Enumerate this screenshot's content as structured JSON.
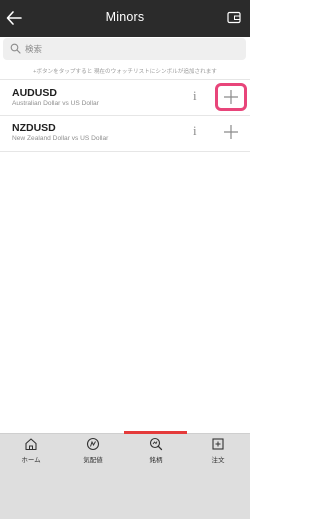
{
  "header": {
    "title": "Minors",
    "back_icon": "arrow-left-icon",
    "right_icon": "wallet-icon"
  },
  "search": {
    "placeholder": "検索",
    "icon": "search-icon"
  },
  "hint_text": "+ボタンをタップすると 現在のウォッチリストにシンボルが追加されます",
  "instruments": [
    {
      "symbol": "AUDUSD",
      "description": "Australian Dollar vs US Dollar",
      "info_label": "i",
      "add_highlighted": true
    },
    {
      "symbol": "NZDUSD",
      "description": "New Zealand Dollar vs US Dollar",
      "info_label": "i",
      "add_highlighted": false
    }
  ],
  "tabs": [
    {
      "label": "ホーム",
      "icon": "home-icon"
    },
    {
      "label": "気配値",
      "icon": "quotes-icon"
    },
    {
      "label": "銘柄",
      "icon": "symbol-search-icon",
      "active": true
    },
    {
      "label": "注文",
      "icon": "order-icon"
    }
  ],
  "colors": {
    "header_bg": "#2b2b2b",
    "active_tab_indicator": "#e43a3a",
    "highlight_border": "#e8457a",
    "tabbar_bg": "#dedede"
  }
}
